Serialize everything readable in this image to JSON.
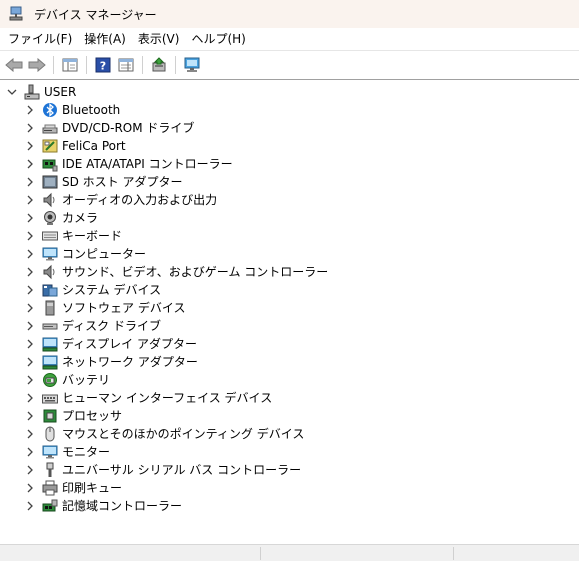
{
  "window": {
    "title": "デバイス マネージャー"
  },
  "menu": [
    {
      "label": "ファイル(F)"
    },
    {
      "label": "操作(A)"
    },
    {
      "label": "表示(V)"
    },
    {
      "label": "ヘルプ(H)"
    }
  ],
  "tree": {
    "root": {
      "label": "USER"
    },
    "categories": [
      {
        "label": "Bluetooth",
        "icon": "bluetooth-icon"
      },
      {
        "label": "DVD/CD-ROM ドライブ",
        "icon": "dvd-drive-icon"
      },
      {
        "label": "FeliCa Port",
        "icon": "felica-icon"
      },
      {
        "label": "IDE ATA/ATAPI コントローラー",
        "icon": "ide-controller-icon"
      },
      {
        "label": "SD ホスト アダプター",
        "icon": "sd-host-icon"
      },
      {
        "label": "オーディオの入力および出力",
        "icon": "speaker-icon"
      },
      {
        "label": "カメラ",
        "icon": "camera-icon"
      },
      {
        "label": "キーボード",
        "icon": "keyboard-icon"
      },
      {
        "label": "コンピューター",
        "icon": "computer-icon"
      },
      {
        "label": "サウンド、ビデオ、およびゲーム コントローラー",
        "icon": "sound-icon"
      },
      {
        "label": "システム デバイス",
        "icon": "system-devices-icon"
      },
      {
        "label": "ソフトウェア デバイス",
        "icon": "software-device-icon"
      },
      {
        "label": "ディスク ドライブ",
        "icon": "disk-drive-icon"
      },
      {
        "label": "ディスプレイ アダプター",
        "icon": "display-adapter-icon"
      },
      {
        "label": "ネットワーク アダプター",
        "icon": "network-adapter-icon"
      },
      {
        "label": "バッテリ",
        "icon": "battery-icon"
      },
      {
        "label": "ヒューマン インターフェイス デバイス",
        "icon": "hid-icon"
      },
      {
        "label": "プロセッサ",
        "icon": "processor-icon"
      },
      {
        "label": "マウスとそのほかのポインティング デバイス",
        "icon": "mouse-icon"
      },
      {
        "label": "モニター",
        "icon": "monitor-icon"
      },
      {
        "label": "ユニバーサル シリアル バス コントローラー",
        "icon": "usb-icon"
      },
      {
        "label": "印刷キュー",
        "icon": "printer-icon"
      },
      {
        "label": "記憶域コントローラー",
        "icon": "storage-controller-icon"
      }
    ]
  }
}
